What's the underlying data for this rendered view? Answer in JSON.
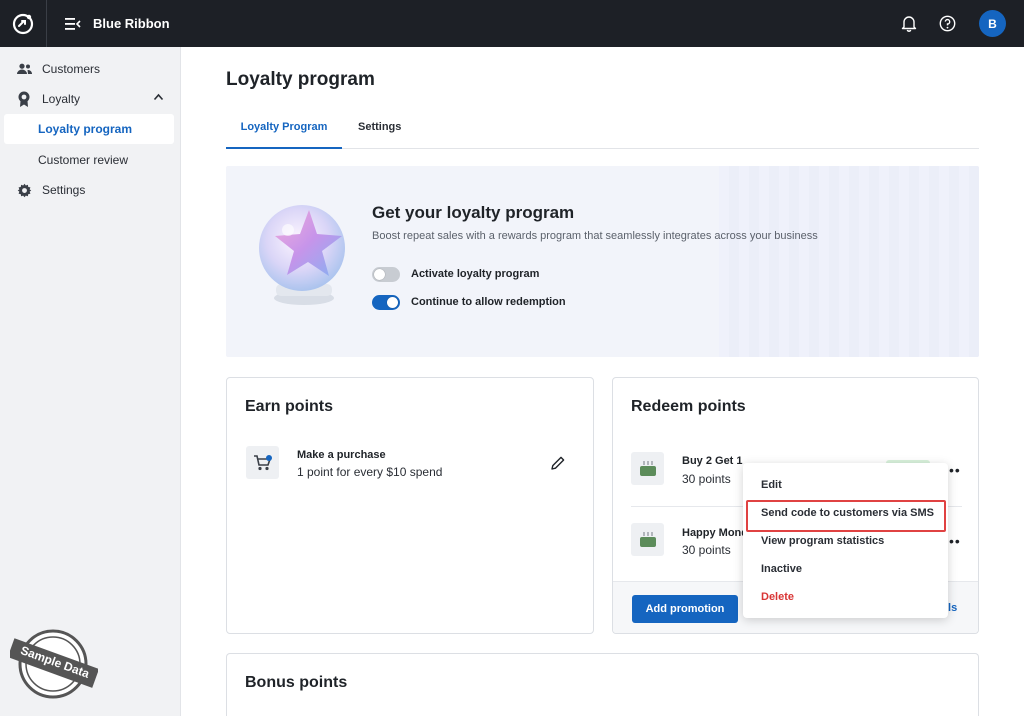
{
  "app": {
    "brand": "Blue Ribbon",
    "avatar_initial": "B"
  },
  "sidebar": {
    "items": [
      {
        "label": "Customers"
      },
      {
        "label": "Loyalty"
      },
      {
        "label": "Loyalty program"
      },
      {
        "label": "Customer review"
      },
      {
        "label": "Settings"
      }
    ],
    "stamp_text": "Sample Data"
  },
  "main": {
    "title": "Loyalty program",
    "tabs": [
      {
        "label": "Loyalty Program"
      },
      {
        "label": "Settings"
      }
    ],
    "hero": {
      "title": "Get your loyalty program",
      "subtitle": "Boost repeat sales with a rewards program that seamlessly integrates across your business",
      "toggles": [
        {
          "label": "Activate loyalty program",
          "on": false
        },
        {
          "label": "Continue to allow redemption",
          "on": true
        }
      ]
    },
    "earn": {
      "title": "Earn points",
      "rule_title": "Make a purchase",
      "rule_desc": "1 point for every $10 spend"
    },
    "redeem": {
      "title": "Redeem points",
      "items": [
        {
          "name": "Buy 2 Get 1",
          "points": "30 points"
        },
        {
          "name": "Happy Mond",
          "points": "30 points"
        }
      ],
      "add_button": "Add promotion",
      "details_link_fragment": "ils"
    },
    "bonus": {
      "title": "Bonus points"
    }
  },
  "context_menu": {
    "items": [
      {
        "label": "Edit"
      },
      {
        "label": "Send code to customers via SMS"
      },
      {
        "label": "View program statistics"
      },
      {
        "label": "Inactive"
      },
      {
        "label": "Delete"
      }
    ]
  },
  "colors": {
    "accent": "#1565c0",
    "danger": "#d93636",
    "topbar": "#1d2026",
    "highlight_border": "#e04242"
  }
}
